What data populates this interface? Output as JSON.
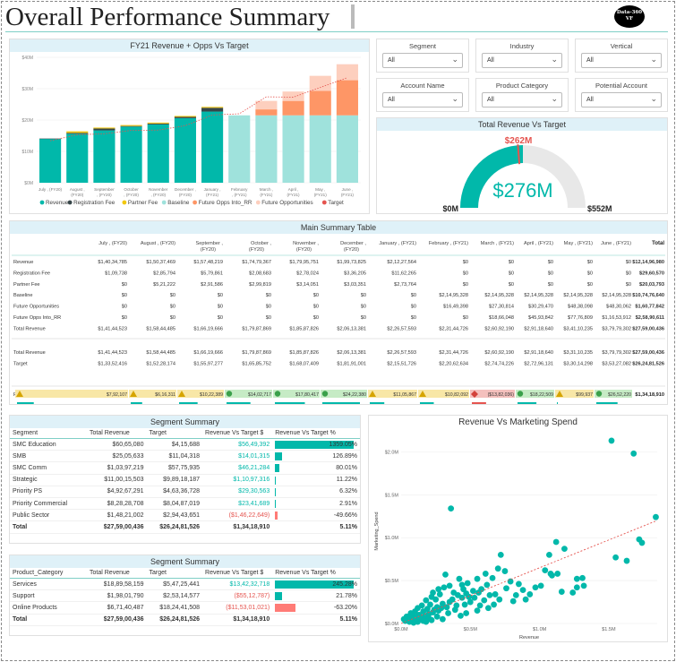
{
  "header": {
    "title": "Overall Performance Summary",
    "logo_line1": "Data-360",
    "logo_line2": "VF"
  },
  "colors": {
    "revenue": "#01b8aa",
    "registration_fee": "#374649",
    "partner_fee": "#f2c80f",
    "baseline": "#9fe2dc",
    "future_opps_into_rr": "#fe9666",
    "future_opportunities": "#fdcfbe",
    "target": "#e5544f"
  },
  "slicers": [
    {
      "label": "Segment",
      "value": "All"
    },
    {
      "label": "Industry",
      "value": "All"
    },
    {
      "label": "Vertical",
      "value": "All"
    },
    {
      "label": "Account Name",
      "value": "All"
    },
    {
      "label": "Product Category",
      "value": "All"
    },
    {
      "label": "Potential Account",
      "value": "All"
    }
  ],
  "chart_data": [
    {
      "type": "bar",
      "title": "FY21 Revenue + Opps Vs Target",
      "stacked": true,
      "categories": [
        "July , (FY20)",
        "August , (FY20)",
        "September , (FY20)",
        "October , (FY20)",
        "November , (FY20)",
        "December , (FY20)",
        "January , (FY21)",
        "February , (FY21)",
        "March , (FY21)",
        "April , (FY21)",
        "May , (FY21)",
        "June , (FY21)"
      ],
      "tick_lines": [
        [
          "July , (FY20)"
        ],
        [
          "August ,",
          "(FY20)"
        ],
        [
          "September",
          ", (FY20)"
        ],
        [
          "October",
          ", (FY20)"
        ],
        [
          "November",
          ", (FY20)"
        ],
        [
          "December ,",
          "(FY20)"
        ],
        [
          "January ,",
          "(FY21)"
        ],
        [
          "February",
          ", (FY21)"
        ],
        [
          "March ,",
          "(FY21)"
        ],
        [
          "April ,",
          "(FY21)"
        ],
        [
          "May ,",
          "(FY21)"
        ],
        [
          "June ,",
          "(FY21)"
        ]
      ],
      "y_ticks": [
        "$0M",
        "$10M",
        "$20M",
        "$30M",
        "$40M"
      ],
      "ylim": [
        0,
        40
      ],
      "series": [
        {
          "name": "Revenue",
          "values": [
            14.0,
            15.6,
            16.7,
            17.9,
            18.6,
            20.6,
            22.7,
            0,
            0,
            0,
            0,
            0
          ]
        },
        {
          "name": "Registration Fee",
          "values": [
            0.1,
            0.3,
            0.6,
            0.2,
            0.3,
            0.4,
            1.2,
            0,
            0,
            0,
            0,
            0
          ]
        },
        {
          "name": "Partner Fee",
          "values": [
            0,
            0.5,
            0.3,
            0.3,
            0.3,
            0.3,
            0.3,
            0,
            0,
            0,
            0,
            0
          ]
        },
        {
          "name": "Baseline",
          "values": [
            0,
            0,
            0,
            0,
            0,
            0,
            0,
            21.5,
            21.5,
            21.5,
            21.5,
            21.5
          ]
        },
        {
          "name": "Future Opps Into_RR",
          "values": [
            0,
            0,
            0,
            0,
            0,
            0,
            0,
            0,
            1.9,
            4.6,
            7.8,
            11.2
          ]
        },
        {
          "name": "Future Opportunities",
          "values": [
            0,
            0,
            0,
            0,
            0,
            0,
            0,
            0,
            2.7,
            3.0,
            4.8,
            5.1
          ]
        },
        {
          "name": "Target",
          "type": "line",
          "values": [
            13.4,
            15.3,
            15.6,
            16.7,
            16.8,
            18.2,
            21.6,
            22.0,
            27.4,
            27.3,
            30.4,
            33.5
          ]
        }
      ],
      "legend": [
        "Revenue",
        "Registration Fee",
        "Partner Fee",
        "Baseline",
        "Future Opps Into_RR",
        "Future Opportunities",
        "Target"
      ],
      "legend_position": "bottom"
    },
    {
      "type": "gauge",
      "title": "Total Revenue Vs Target",
      "value": 276,
      "value_label": "$276M",
      "target": 262,
      "target_label": "$262M",
      "min_label": "$0M",
      "max_label": "$552M",
      "max": 552
    },
    {
      "type": "table",
      "title": "Main Summary Table",
      "columns": [
        "",
        "July , (FY20)",
        "August , (FY20)",
        "September , (FY20)",
        "October , (FY20)",
        "November , (FY20)",
        "December , (FY20)",
        "January , (FY21)",
        "February , (FY21)",
        "March , (FY21)",
        "April , (FY21)",
        "May , (FY21)",
        "June , (FY21)",
        "Total"
      ],
      "rows": [
        [
          "Revenue",
          "$1,40,34,785",
          "$1,50,37,469",
          "$1,57,48,219",
          "$1,74,79,367",
          "$1,79,95,751",
          "$1,99,73,825",
          "$2,12,27,564",
          "$0",
          "$0",
          "$0",
          "$0",
          "$0",
          "$12,14,96,980"
        ],
        [
          "Registration Fee",
          "$1,09,738",
          "$2,85,794",
          "$5,79,861",
          "$2,08,683",
          "$2,78,024",
          "$3,36,205",
          "$11,62,265",
          "$0",
          "$0",
          "$0",
          "$0",
          "$0",
          "$29,60,570"
        ],
        [
          "Partner Fee",
          "$0",
          "$5,21,222",
          "$2,91,586",
          "$2,99,819",
          "$3,14,051",
          "$3,03,351",
          "$2,73,764",
          "$0",
          "$0",
          "$0",
          "$0",
          "$0",
          "$20,03,793"
        ],
        [
          "Baseline",
          "$0",
          "$0",
          "$0",
          "$0",
          "$0",
          "$0",
          "$0",
          "$2,14,95,328",
          "$2,14,95,328",
          "$2,14,95,328",
          "$2,14,95,328",
          "$2,14,95,328",
          "$10,74,76,640"
        ],
        [
          "Future Opportunities",
          "$0",
          "$0",
          "$0",
          "$0",
          "$0",
          "$0",
          "$0",
          "$16,49,398",
          "$27,30,814",
          "$30,29,470",
          "$48,38,098",
          "$48,30,062",
          "$1,60,77,842"
        ],
        [
          "Future Opps Into_RR",
          "$0",
          "$0",
          "$0",
          "$0",
          "$0",
          "$0",
          "$0",
          "$0",
          "$18,66,048",
          "$45,93,842",
          "$77,76,809",
          "$1,16,53,912",
          "$2,58,90,611"
        ],
        [
          "Total Revenue",
          "$1,41,44,523",
          "$1,58,44,485",
          "$1,66,19,666",
          "$1,79,87,869",
          "$1,85,87,826",
          "$2,06,13,381",
          "$2,26,57,593",
          "$2,31,44,726",
          "$2,60,92,190",
          "$2,91,18,640",
          "$3,41,10,235",
          "$3,79,79,302",
          "$27,59,00,436"
        ]
      ],
      "rows2": [
        [
          "Total Revenue",
          "$1,41,44,523",
          "$1,58,44,485",
          "$1,66,19,666",
          "$1,79,87,869",
          "$1,85,87,826",
          "$2,06,13,381",
          "$2,26,57,593",
          "$2,31,44,726",
          "$2,60,92,190",
          "$2,91,18,640",
          "$3,31,10,235",
          "$3,79,79,302",
          "$27,59,00,436"
        ],
        [
          "Target",
          "$1,33,52,416",
          "$1,52,28,174",
          "$1,55,97,277",
          "$1,65,85,752",
          "$1,68,07,409",
          "$1,81,91,001",
          "$2,15,51,726",
          "$2,20,62,634",
          "$2,74,74,226",
          "$2,72,96,131",
          "$3,30,14,298",
          "$3,53,27,082",
          "$26,24,81,526"
        ]
      ],
      "rvt_label": "Revenue Vs Target $",
      "rvt_values": [
        "$7,92,107",
        "$6,16,311",
        "$10,22,389",
        "$14,02,717",
        "$17,80,417",
        "$24,22,380",
        "$11,05,867",
        "$10,82,092",
        "($13,82,036)",
        "$18,22,509",
        "$99,937",
        "$26,52,220"
      ],
      "rvt_total": "$1,34,18,910",
      "rvt_status": [
        "warn",
        "warn",
        "warn",
        "good",
        "good",
        "good",
        "warn",
        "warn",
        "bad",
        "good",
        "warn",
        "good"
      ],
      "rvtp_label": "Revenue Vs Target %",
      "rvtp_values": [
        "5.93%",
        "4.05%",
        "6.55%",
        "8.46%",
        "10.6%",
        "13.3%",
        "5.13%",
        "4.90%",
        "-5.03%",
        "6.68%",
        "0.29%",
        "7.51%"
      ],
      "rvtp_numbers": [
        5.93,
        4.05,
        6.55,
        8.46,
        10.6,
        13.3,
        5.13,
        4.9,
        -5.03,
        6.68,
        0.29,
        7.51
      ],
      "rvtp_total": "5.11%"
    },
    {
      "type": "table",
      "title": "Segment Summary",
      "columns": [
        "Segment",
        "Total Revenue",
        "Target",
        "Revenue Vs Target $",
        "Revenue Vs Target %"
      ],
      "rows": [
        [
          "SMC Education",
          "$60,65,080",
          "$4,15,688",
          "$56,49,392",
          "1359.05%"
        ],
        [
          "SMB",
          "$25,05,633",
          "$11,04,318",
          "$14,01,315",
          "126.89%"
        ],
        [
          "SMC Comm",
          "$1,03,97,219",
          "$57,75,935",
          "$46,21,284",
          "80.01%"
        ],
        [
          "Strategic",
          "$11,00,15,503",
          "$9,89,18,187",
          "$1,10,97,316",
          "11.22%"
        ],
        [
          "Priority PS",
          "$4,92,67,291",
          "$4,63,36,728",
          "$29,30,563",
          "6.32%"
        ],
        [
          "Priority Commercial",
          "$8,28,28,708",
          "$8,04,87,019",
          "$23,41,689",
          "2.91%"
        ],
        [
          "Public Sector",
          "$1,48,21,002",
          "$2,94,43,651",
          "($1,46,22,649)",
          "-49.66%"
        ]
      ],
      "pct_numbers": [
        1359.05,
        126.89,
        80.01,
        11.22,
        6.32,
        2.91,
        -49.66
      ],
      "total": [
        "Total",
        "$27,59,00,436",
        "$26,24,81,526",
        "$1,34,18,910",
        "5.11%"
      ]
    },
    {
      "type": "table",
      "title": "Segment Summary",
      "columns": [
        "Product_Category",
        "Total Revenue",
        "Target",
        "Revenue Vs Target $",
        "Revenue Vs Target %"
      ],
      "rows": [
        [
          "Services",
          "$18,89,58,159",
          "$5,47,25,441",
          "$13,42,32,718",
          "245.28%"
        ],
        [
          "Support",
          "$1,98,01,790",
          "$2,53,14,577",
          "($55,12,787)",
          "21.78%"
        ],
        [
          "Online Products",
          "$6,71,40,487",
          "$18,24,41,508",
          "($11,53,01,021)",
          "-63.20%"
        ]
      ],
      "pct_numbers": [
        245.28,
        21.78,
        -63.2
      ],
      "total": [
        "Total",
        "$27,59,00,436",
        "$26,24,81,526",
        "$1,34,18,910",
        "5.11%"
      ]
    },
    {
      "type": "scatter",
      "title": "Revenue Vs Marketing Spend",
      "xlabel": "Revenue",
      "ylabel": "Marketing_Spend",
      "x_ticks": [
        "$0.0M",
        "$0.5M",
        "$1.0M",
        "$1.5M"
      ],
      "y_ticks": [
        "$0.0M",
        "$0.5M",
        "$1.0M",
        "$1.5M",
        "$2.0M"
      ],
      "xlim": [
        0,
        1.85
      ],
      "ylim": [
        0,
        2.15
      ],
      "trend": [
        [
          0,
          0
        ],
        [
          1.85,
          1.2
        ]
      ],
      "points": [
        [
          1.52,
          2.13
        ],
        [
          1.68,
          1.98
        ],
        [
          1.84,
          1.24
        ],
        [
          1.72,
          0.98
        ],
        [
          1.74,
          0.94
        ],
        [
          1.55,
          0.77
        ],
        [
          1.63,
          0.73
        ],
        [
          1.12,
          0.95
        ],
        [
          1.18,
          0.87
        ],
        [
          1.07,
          0.8
        ],
        [
          1.13,
          0.58
        ],
        [
          1.04,
          0.62
        ],
        [
          1.08,
          0.58
        ],
        [
          1.27,
          0.52
        ],
        [
          1.27,
          0.42
        ],
        [
          1.31,
          0.53
        ],
        [
          1.32,
          0.44
        ],
        [
          1.24,
          0.36
        ],
        [
          1.16,
          0.37
        ],
        [
          1.09,
          0.56
        ],
        [
          1.01,
          0.44
        ],
        [
          0.93,
          0.34
        ],
        [
          0.88,
          0.39
        ],
        [
          0.81,
          0.26
        ],
        [
          0.75,
          0.61
        ],
        [
          0.7,
          0.64
        ],
        [
          0.76,
          0.41
        ],
        [
          0.68,
          0.34
        ],
        [
          0.72,
          0.8
        ],
        [
          0.61,
          0.58
        ],
        [
          0.55,
          0.52
        ],
        [
          0.58,
          0.4
        ],
        [
          0.48,
          0.47
        ],
        [
          0.52,
          0.38
        ],
        [
          0.6,
          0.27
        ],
        [
          0.42,
          0.52
        ],
        [
          0.36,
          1.34
        ],
        [
          0.38,
          0.36
        ],
        [
          0.44,
          0.3
        ],
        [
          0.4,
          0.21
        ],
        [
          0.31,
          0.42
        ],
        [
          0.28,
          0.34
        ],
        [
          0.3,
          0.23
        ],
        [
          0.32,
          0.57
        ],
        [
          0.25,
          0.28
        ],
        [
          0.22,
          0.31
        ],
        [
          0.26,
          0.19
        ],
        [
          0.21,
          0.22
        ],
        [
          0.18,
          0.27
        ],
        [
          0.19,
          0.17
        ],
        [
          0.15,
          0.21
        ],
        [
          0.16,
          0.14
        ],
        [
          0.12,
          0.18
        ],
        [
          0.13,
          0.1
        ],
        [
          0.1,
          0.14
        ],
        [
          0.09,
          0.09
        ],
        [
          0.07,
          0.12
        ],
        [
          0.06,
          0.07
        ],
        [
          0.08,
          0.05
        ],
        [
          0.05,
          0.04
        ],
        [
          0.04,
          0.08
        ],
        [
          0.03,
          0.03
        ],
        [
          0.02,
          0.05
        ],
        [
          0.11,
          0.06
        ],
        [
          0.14,
          0.05
        ],
        [
          0.17,
          0.08
        ],
        [
          0.2,
          0.11
        ],
        [
          0.23,
          0.13
        ],
        [
          0.27,
          0.15
        ],
        [
          0.33,
          0.19
        ],
        [
          0.35,
          0.25
        ],
        [
          0.29,
          0.18
        ],
        [
          0.24,
          0.16
        ],
        [
          0.2,
          0.06
        ],
        [
          0.16,
          0.03
        ],
        [
          0.12,
          0.02
        ],
        [
          0.26,
          0.08
        ],
        [
          0.34,
          0.12
        ],
        [
          0.39,
          0.16
        ],
        [
          0.46,
          0.22
        ],
        [
          0.5,
          0.25
        ],
        [
          0.53,
          0.3
        ],
        [
          0.45,
          0.4
        ],
        [
          0.41,
          0.33
        ],
        [
          0.37,
          0.28
        ],
        [
          0.57,
          0.21
        ],
        [
          0.63,
          0.18
        ],
        [
          0.67,
          0.22
        ],
        [
          0.47,
          0.12
        ],
        [
          0.43,
          0.09
        ],
        [
          0.3,
          0.05
        ],
        [
          0.22,
          0.04
        ],
        [
          0.18,
          0.02
        ],
        [
          0.09,
          0.01
        ],
        [
          0.06,
          0.02
        ],
        [
          0.55,
          0.15
        ],
        [
          0.49,
          0.31
        ],
        [
          0.62,
          0.45
        ],
        [
          0.66,
          0.53
        ],
        [
          0.79,
          0.49
        ],
        [
          0.85,
          0.46
        ],
        [
          0.9,
          0.28
        ],
        [
          0.97,
          0.42
        ],
        [
          0.64,
          0.33
        ],
        [
          0.56,
          0.36
        ],
        [
          0.71,
          0.28
        ],
        [
          0.83,
          0.33
        ],
        [
          0.44,
          0.45
        ],
        [
          0.47,
          0.35
        ],
        [
          0.35,
          0.44
        ],
        [
          0.27,
          0.4
        ],
        [
          0.23,
          0.36
        ]
      ]
    }
  ]
}
